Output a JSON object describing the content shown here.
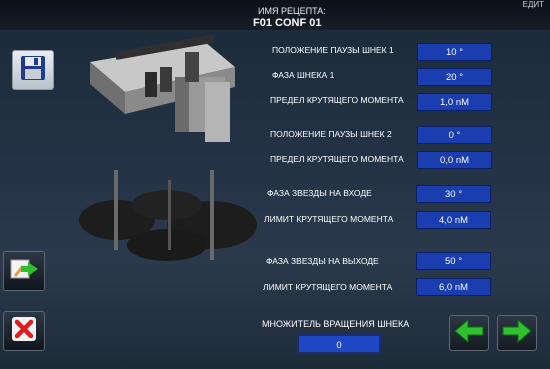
{
  "header": {
    "recipe_label": "ИМЯ РЕЦЕПТА:",
    "recipe_name": "F01 CONF 01",
    "corner_text": "ЕДИТ"
  },
  "screw": {
    "rows": [
      {
        "label": "ПОЛОЖЕНИЕ ПАУЗЫ ШНЕК 1",
        "value": "10 °"
      },
      {
        "label": "ФАЗА ШНЕКА 1",
        "value": "20 °"
      },
      {
        "label": "ПРЕДЕЛ КРУТЯЩЕГО МОМЕНТА",
        "value": "1,0 nM"
      },
      {
        "label": "ПОЛОЖЕНИЕ ПАУЗЫ ШНЕК 2",
        "value": "0 °"
      },
      {
        "label": "ПРЕДЕЛ КРУТЯЩЕГО МОМЕНТА",
        "value": "0,0 nM"
      }
    ]
  },
  "star": {
    "rows": [
      {
        "label": "ФАЗА ЗВЕЗДЫ НА ВХОДЕ",
        "value": "30 °"
      },
      {
        "label": "ЛИМИТ КРУТЯЩЕГО МОМЕНТА",
        "value": "4,0 nM"
      },
      {
        "label": "ФАЗА ЗВЕЗДЫ НА ВЫХОДЕ",
        "value": "50 °"
      },
      {
        "label": "ЛИМИТ КРУТЯЩЕГО МОМЕНТА",
        "value": "6,0 nM"
      }
    ]
  },
  "multiplier": {
    "label": "МНОЖИТЕЛЬ ВРАЩЕНИЯ ШНЕКА",
    "value": "0"
  },
  "icons": {
    "save": "floppy-disk-icon",
    "edit": "edit-arrow-icon",
    "cancel": "close-icon",
    "prev": "arrow-left-icon",
    "next": "arrow-right-icon"
  },
  "colors": {
    "field_blue": "#1a3db0",
    "arrow_green": "#2fbf2f",
    "cancel_red": "#e02020"
  }
}
